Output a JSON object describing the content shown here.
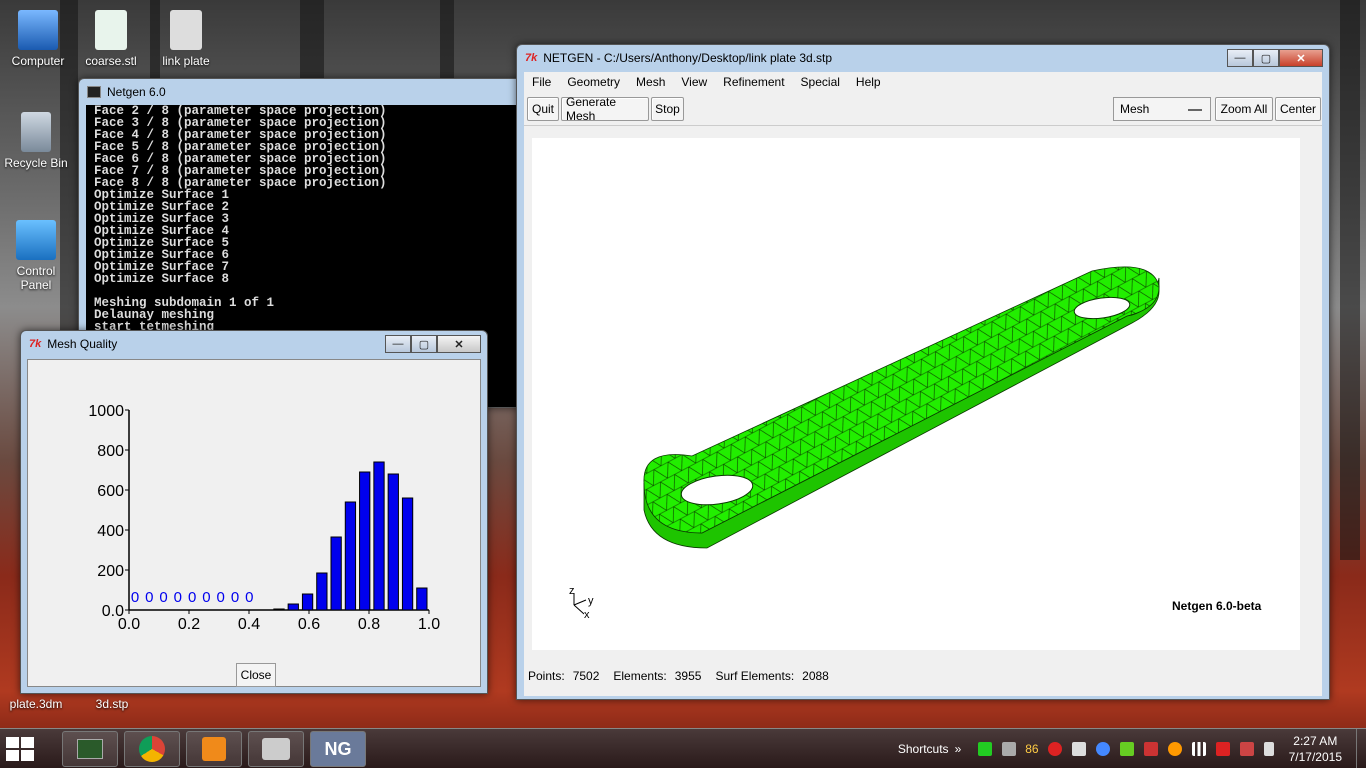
{
  "desktop": {
    "icons": [
      {
        "label": "Computer"
      },
      {
        "label": "coarse.stl"
      },
      {
        "label": "link plate"
      },
      {
        "label": "Recycle Bin"
      },
      {
        "label": "Control Panel"
      },
      {
        "label": "plate.3dm"
      },
      {
        "label": "3d.stp"
      }
    ]
  },
  "console": {
    "title": "Netgen 6.0",
    "lines": "Face 2 / 8 (parameter space projection)\nFace 3 / 8 (parameter space projection)\nFace 4 / 8 (parameter space projection)\nFace 5 / 8 (parameter space projection)\nFace 6 / 8 (parameter space projection)\nFace 7 / 8 (parameter space projection)\nFace 8 / 8 (parameter space projection)\nOptimize Surface 1\nOptimize Surface 2\nOptimize Surface 3\nOptimize Surface 4\nOptimize Surface 5\nOptimize Surface 6\nOptimize Surface 7\nOptimize Surface 8\n\nMeshing subdomain 1 of 1\nDelaunay meshing\nstart tetmeshing"
  },
  "netgen": {
    "title": "NETGEN - C:/Users/Anthony/Desktop/link plate 3d.stp",
    "menu": [
      "File",
      "Geometry",
      "Mesh",
      "View",
      "Refinement",
      "Special",
      "Help"
    ],
    "toolbar": {
      "quit": "Quit",
      "generate": "Generate Mesh",
      "stop": "Stop",
      "mesh_select": "Mesh",
      "zoom_all": "Zoom All",
      "center": "Center"
    },
    "viewport": {
      "version_label": "Netgen 6.0-beta",
      "axis_z": "z",
      "axis_y": "y",
      "axis_x": "x",
      "mesh_color": "#22ee00"
    },
    "status": {
      "points_label": "Points:",
      "points": "7502",
      "elements_label": "Elements:",
      "elements": "3955",
      "surf_label": "Surf Elements:",
      "surf": "2088"
    }
  },
  "mesh_quality": {
    "title": "Mesh Quality",
    "close_label": "Close"
  },
  "chart_data": {
    "type": "bar",
    "x": [
      0.0,
      0.05,
      0.1,
      0.15,
      0.2,
      0.25,
      0.3,
      0.35,
      0.4,
      0.45,
      0.5,
      0.55,
      0.6,
      0.65,
      0.7,
      0.75,
      0.8,
      0.85,
      0.9,
      0.95
    ],
    "values": [
      0,
      0,
      0,
      0,
      0,
      0,
      0,
      0,
      0,
      0,
      5,
      30,
      80,
      185,
      365,
      540,
      690,
      740,
      680,
      560,
      110
    ],
    "zero_labels": [
      "0",
      "0",
      "0",
      "0",
      "0",
      "0",
      "0",
      "0",
      "0"
    ],
    "xlim": [
      0.0,
      1.0
    ],
    "ylim": [
      0,
      1000
    ],
    "xticks": [
      "0.0",
      "0.2",
      "0.4",
      "0.6",
      "0.8",
      "1.0"
    ],
    "yticks": [
      "0.0",
      "200",
      "400",
      "600",
      "800",
      "1000"
    ],
    "bar_color": "#0000ee",
    "grid": false
  },
  "taskbar": {
    "shortcuts_label": "Shortcuts",
    "tray_number": "86",
    "time": "2:27 AM",
    "date": "7/17/2015",
    "ng_label": "NG"
  }
}
